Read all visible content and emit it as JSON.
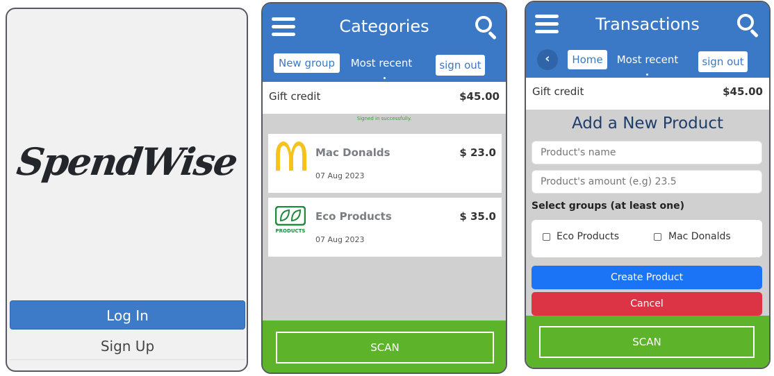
{
  "login_screen": {
    "logo_text": "SpendWise",
    "login_label": "Log In",
    "signup_label": "Sign Up"
  },
  "categories_screen": {
    "title": "Categories",
    "tabs": {
      "new_group": "New group",
      "most_recent": "Most recent",
      "sign_out": "sign out"
    },
    "gift": {
      "label": "Gift credit",
      "amount": "$45.00"
    },
    "toast": "Signed in successfully.",
    "cards": [
      {
        "name": "Mac Donalds",
        "date": "07 Aug 2023",
        "amount": "$ 23.0",
        "icon": "mcdonalds-logo-icon"
      },
      {
        "name": "Eco Products",
        "date": "07 Aug 2023",
        "amount": "$ 35.0",
        "icon": "eco-products-logo-icon",
        "logo_caption": "PRODUCTS"
      }
    ],
    "scan_label": "SCAN"
  },
  "transactions_screen": {
    "title": "Transactions",
    "back_glyph": "‹",
    "tabs": {
      "home": "Home",
      "most_recent": "Most recent",
      "sign_out": "sign out"
    },
    "gift": {
      "label": "Gift credit",
      "amount": "$45.00"
    },
    "form": {
      "heading": "Add a New Product",
      "name_placeholder": "Product's name",
      "amount_placeholder": "Product's amount (e.g) 23.5",
      "groups_label": "Select groups (at least one)",
      "group_options": [
        "Eco Products",
        "Mac Donalds"
      ],
      "create_label": "Create Product",
      "cancel_label": "Cancel"
    },
    "scan_label": "SCAN"
  },
  "colors": {
    "header_blue": "#3b78c5",
    "scan_green": "#5db42a",
    "create_blue": "#1a74f5",
    "cancel_red": "#dd3445"
  }
}
